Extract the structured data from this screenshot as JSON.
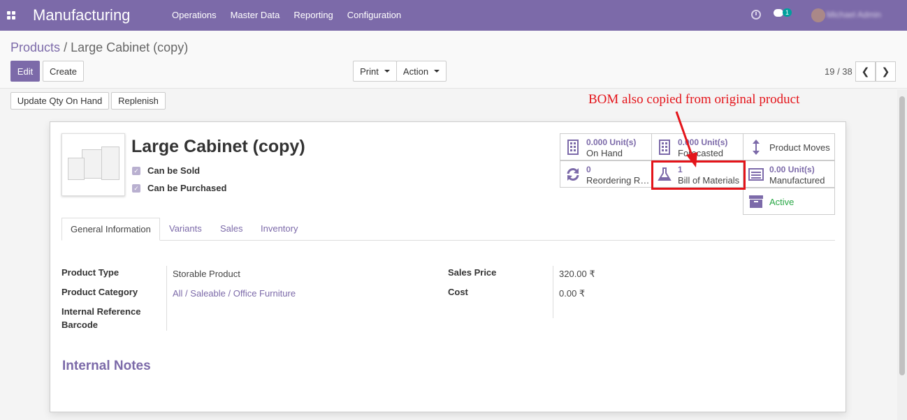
{
  "navbar": {
    "app_name": "Manufacturing",
    "menu": [
      "Operations",
      "Master Data",
      "Reporting",
      "Configuration"
    ],
    "chat_badge": "1",
    "user_name": "Michael Admin"
  },
  "breadcrumb": {
    "parent": "Products",
    "separator": "/",
    "current": "Large Cabinet (copy)"
  },
  "toolbar": {
    "edit": "Edit",
    "create": "Create",
    "print": "Print",
    "action": "Action",
    "pager": "19 / 38",
    "prev": "❮",
    "next": "❯"
  },
  "statusbar": {
    "update_qty": "Update Qty On Hand",
    "replenish": "Replenish"
  },
  "annotation": "BOM also copied from original product",
  "product": {
    "name": "Large Cabinet (copy)",
    "can_be_sold": "Can be Sold",
    "can_be_purchased": "Can be Purchased"
  },
  "smart_buttons": {
    "on_hand": {
      "value": "0.000",
      "unit": "Unit(s)",
      "label": "On Hand"
    },
    "forecasted": {
      "value": "0.000",
      "unit": "Unit(s)",
      "label": "Forecasted"
    },
    "product_moves": {
      "label": "Product Moves"
    },
    "reordering": {
      "value": "0",
      "label": "Reordering Rules"
    },
    "bom": {
      "value": "1",
      "label": "Bill of Materials"
    },
    "manufactured": {
      "value": "0.00",
      "unit": "Unit(s)",
      "label": "Manufactured"
    },
    "active": {
      "label": "Active"
    }
  },
  "tabs": [
    "General Information",
    "Variants",
    "Sales",
    "Inventory"
  ],
  "fields": {
    "product_type": {
      "label": "Product Type",
      "value": "Storable Product"
    },
    "product_category": {
      "label": "Product Category",
      "value": "All / Saleable / Office Furniture"
    },
    "internal_reference": {
      "label": "Internal Reference"
    },
    "barcode": {
      "label": "Barcode"
    },
    "sales_price": {
      "label": "Sales Price",
      "value": "320.00 ₹"
    },
    "cost": {
      "label": "Cost",
      "value": "0.00 ₹"
    }
  },
  "internal_notes": "Internal Notes",
  "colors": {
    "brand": "#7c6aa9",
    "highlight": "#e4141a",
    "active": "#28a745"
  }
}
